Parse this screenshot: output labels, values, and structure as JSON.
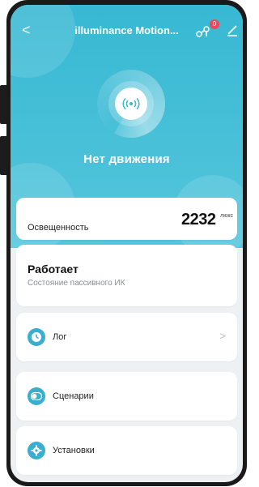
{
  "header": {
    "back_glyph": "<",
    "title": "illuminance Motion...",
    "notification_count": "0"
  },
  "status_text": "Нет движения",
  "illuminance": {
    "label": "Освещенность",
    "value": "2232",
    "unit": "люкс"
  },
  "pir": {
    "state": "Работает",
    "label": "Состояние пассивного ИК"
  },
  "menu": {
    "log": "Лог",
    "chevron": ">",
    "scenes": "Сценарии",
    "settings": "Установки"
  },
  "colors": {
    "accent": "#37b8d3",
    "icon_bg": "#3aaed0",
    "badge": "#f2465a",
    "background": "#eef1f4"
  },
  "icons": {
    "back": "chevron-left-icon",
    "share": "share-icon",
    "edit": "edit-icon",
    "motion": "motion-waves-icon",
    "log": "clock-icon",
    "scenes": "toggle-icon",
    "settings": "gear-icon"
  }
}
